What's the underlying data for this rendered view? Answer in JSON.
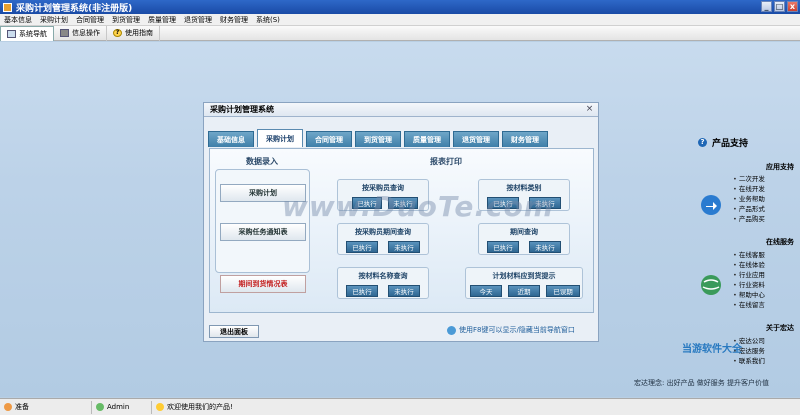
{
  "window": {
    "title": "采购计划管理系统(非注册版)",
    "btn_min": "_",
    "btn_max": "□",
    "btn_close": "x"
  },
  "menu": [
    "基本信息",
    "采购计划",
    "合同管理",
    "到货管理",
    "质量管理",
    "退货管理",
    "财务管理",
    "系统(S)"
  ],
  "toolbar": {
    "nav": "系统导航",
    "info": "信息操作",
    "guide": "使用指南"
  },
  "dialog": {
    "title": "采购计划管理系统",
    "close": "×",
    "tabs": [
      "基础信息",
      "采购计划",
      "合同管理",
      "到货管理",
      "质量管理",
      "退货管理",
      "财务管理"
    ],
    "active_tab": "采购计划",
    "section_entry": "数据录入",
    "section_report": "报表打印",
    "entry_buttons": [
      "采购计划",
      "采购任务通知表"
    ],
    "red_button": "期间到货情况表",
    "groups": [
      {
        "label": "按采购员查询",
        "buttons": [
          "已执行",
          "未执行"
        ]
      },
      {
        "label": "按材料类别",
        "buttons": [
          "已执行",
          "未执行"
        ]
      },
      {
        "label": "按采购员期间查询",
        "buttons": [
          "已执行",
          "未执行"
        ]
      },
      {
        "label": "期间查询",
        "buttons": [
          "已执行",
          "未执行"
        ]
      },
      {
        "label": "按材料名称查询",
        "buttons": [
          "已执行",
          "未执行"
        ]
      },
      {
        "label": "计划材料应到货提示",
        "buttons": [
          "今天",
          "近期",
          "已误期"
        ]
      }
    ],
    "exit": "退出面板",
    "f8_tip": "使用F8键可以显示/隐藏当前导航窗口"
  },
  "support": {
    "title": "产品支持",
    "groups": [
      {
        "title": "应用支持",
        "items": [
          "二次开发",
          "在线开发",
          "业务帮助",
          "产品形式",
          "产品购买"
        ]
      },
      {
        "title": "在线服务",
        "items": [
          "在线客服",
          "在线体验",
          "行业应用",
          "行业资料",
          "帮助中心",
          "在线留言"
        ]
      },
      {
        "title": "关于宏达",
        "items": [
          "宏达公司",
          "宏达服务",
          "联系我们"
        ]
      }
    ],
    "slogan": "宏达理念: 出好产品  做好服务  提升客户价值"
  },
  "watermark": "www.DuoTe.com",
  "site_logo": "当游软件大全",
  "status": {
    "ready": "准备",
    "user": "Admin",
    "welcome": "欢迎使用我们的产品!"
  },
  "colors": {
    "titlebar": "#2e68c8",
    "tab": "#3f7fa9",
    "desk": "#bcd2e8",
    "red_text": "#c31f1f"
  }
}
